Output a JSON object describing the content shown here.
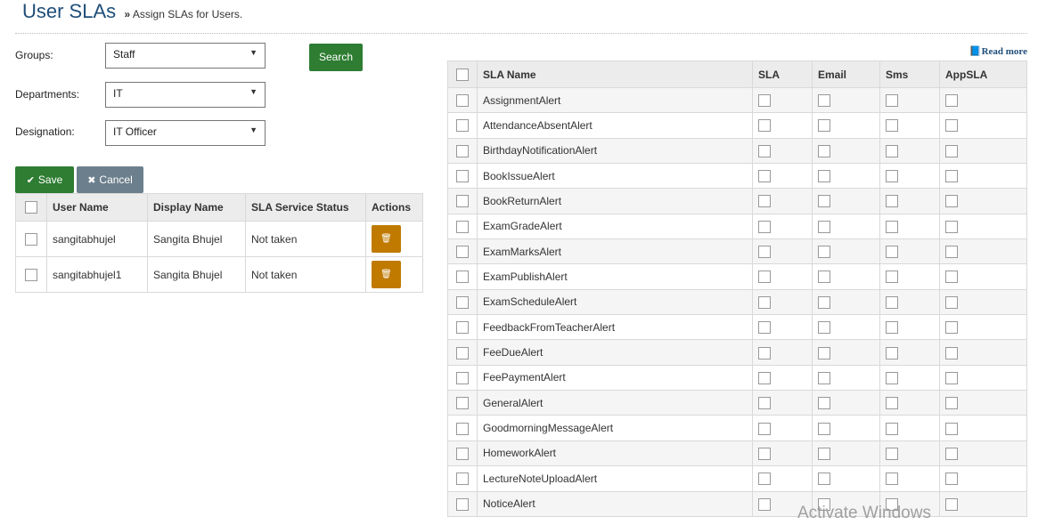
{
  "header": {
    "title": "User SLAs",
    "separator": "»",
    "subtitle": "Assign SLAs for Users."
  },
  "filters": {
    "groups": {
      "label": "Groups:",
      "value": "Staff"
    },
    "departments": {
      "label": "Departments:",
      "value": "IT"
    },
    "designation": {
      "label": "Designation:",
      "value": "IT Officer"
    },
    "dropdown_arrow": "▼"
  },
  "buttons": {
    "search": "Search",
    "save": "Save",
    "cancel": "Cancel",
    "read_more": "Read more"
  },
  "icons": {
    "save": "check-icon",
    "cancel": "times-icon",
    "delete": "trash-icon",
    "read_more": "book-icon"
  },
  "colors": {
    "primary_green": "#2e7d32",
    "cancel_gray": "#6c7f8c",
    "delete_orange": "#c07a00",
    "title_blue": "#1f4e79"
  },
  "users_table": {
    "columns": [
      "User Name",
      "Display Name",
      "SLA Service Status",
      "Actions"
    ],
    "rows": [
      {
        "user_name": "sangitabhujel",
        "display_name": "Sangita Bhujel",
        "status": "Not taken"
      },
      {
        "user_name": "sangitabhujel1",
        "display_name": "Sangita Bhujel",
        "status": "Not taken"
      }
    ]
  },
  "sla_table": {
    "columns": [
      "SLA Name",
      "SLA",
      "Email",
      "Sms",
      "AppSLA"
    ],
    "rows": [
      "AssignmentAlert",
      "AttendanceAbsentAlert",
      "BirthdayNotificationAlert",
      "BookIssueAlert",
      "BookReturnAlert",
      "ExamGradeAlert",
      "ExamMarksAlert",
      "ExamPublishAlert",
      "ExamScheduleAlert",
      "FeedbackFromTeacherAlert",
      "FeeDueAlert",
      "FeePaymentAlert",
      "GeneralAlert",
      "GoodmorningMessageAlert",
      "HomeworkAlert",
      "LectureNoteUploadAlert",
      "NoticeAlert"
    ]
  },
  "watermark": "Activate Windows"
}
